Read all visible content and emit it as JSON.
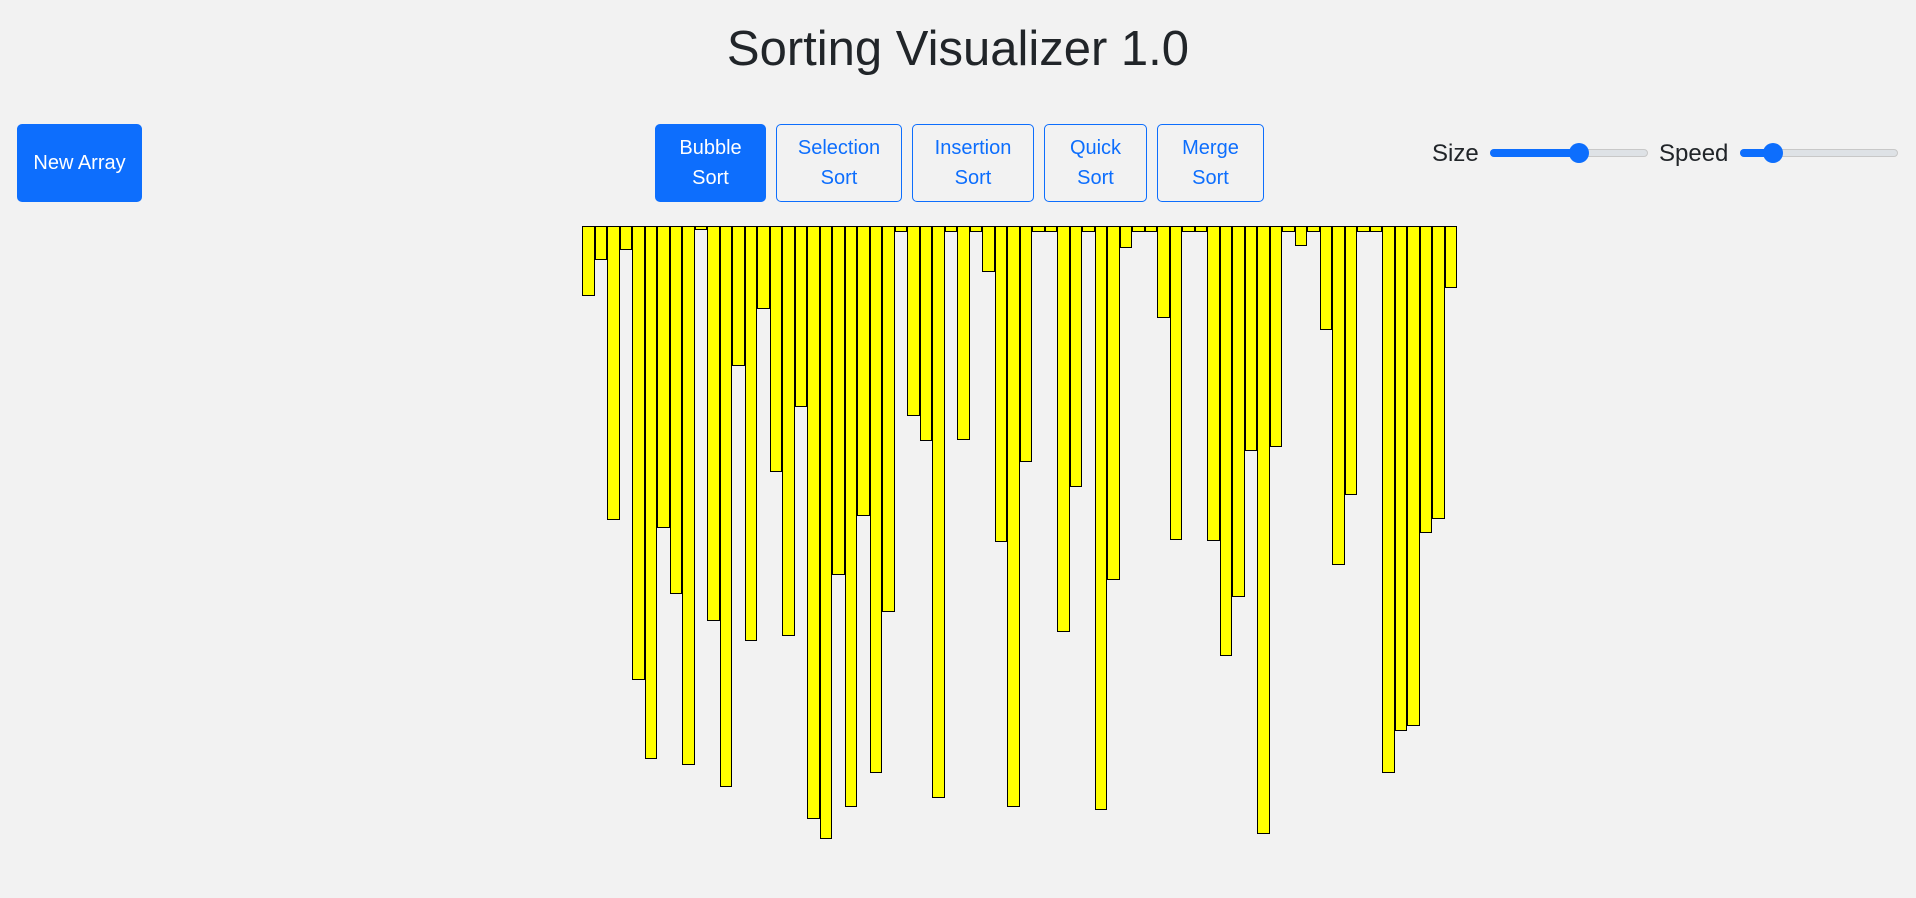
{
  "page": {
    "title": "Sorting Visualizer 1.0"
  },
  "toolbar": {
    "new_array_label": "New Array",
    "algorithms": [
      {
        "line1": "Bubble",
        "line2": "Sort",
        "active": true
      },
      {
        "line1": "Selection",
        "line2": "Sort",
        "active": false
      },
      {
        "line1": "Insertion",
        "line2": "Sort",
        "active": false
      },
      {
        "line1": "Quick",
        "line2": "Sort",
        "active": false
      },
      {
        "line1": "Merge",
        "line2": "Sort",
        "active": false
      }
    ]
  },
  "controls": {
    "size": {
      "label": "Size",
      "value": 0.57
    },
    "speed": {
      "label": "Speed",
      "value": 0.17
    }
  },
  "colors": {
    "primary": "#0d6efd",
    "bar_fill": "#ffff00",
    "bar_border": "#000000",
    "background": "#f2f2f2"
  },
  "array": {
    "values": [
      70,
      34,
      294,
      24,
      454,
      533,
      302,
      368,
      539,
      4,
      395,
      561,
      140,
      415,
      83,
      246,
      410,
      181,
      593,
      613,
      349,
      581,
      290,
      547,
      386,
      6,
      190,
      215,
      572,
      6,
      214,
      6,
      46,
      316,
      581,
      236,
      6,
      6,
      406,
      261,
      6,
      584,
      354,
      22,
      6,
      6,
      92,
      314,
      6,
      6,
      315,
      430,
      371,
      225,
      608,
      221,
      6,
      20,
      6,
      104,
      339,
      269,
      6,
      6,
      547,
      505,
      500,
      307,
      293,
      62
    ]
  }
}
